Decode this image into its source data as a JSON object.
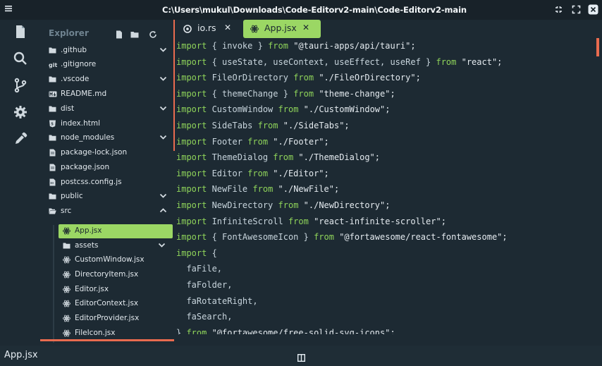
{
  "window": {
    "title": "C:\\Users\\mukul\\Downloads\\Code-Editorv2-main\\Code-Editorv2-main"
  },
  "activity_bar": [
    "files-icon",
    "search-icon",
    "source-control-icon",
    "settings-icon",
    "eyedropper-icon"
  ],
  "explorer": {
    "title": "Explorer",
    "tree": [
      {
        "label": ".github",
        "icon": "folder-icon",
        "chevron": true
      },
      {
        "label": ".gitignore",
        "icon": "git-icon",
        "chevron": false
      },
      {
        "label": ".vscode",
        "icon": "folder-icon",
        "chevron": true
      },
      {
        "label": "README.md",
        "icon": "markdown-icon",
        "chevron": false
      },
      {
        "label": "dist",
        "icon": "folder-icon",
        "chevron": true
      },
      {
        "label": "index.html",
        "icon": "html-icon",
        "chevron": false
      },
      {
        "label": "node_modules",
        "icon": "folder-icon",
        "chevron": true
      },
      {
        "label": "package-lock.json",
        "icon": "file-icon",
        "chevron": false
      },
      {
        "label": "package.json",
        "icon": "file-icon",
        "chevron": false
      },
      {
        "label": "postcss.config.js",
        "icon": "js-icon",
        "chevron": false
      },
      {
        "label": "public",
        "icon": "folder-icon",
        "chevron": true
      },
      {
        "label": "src",
        "icon": "folder-open-icon",
        "chevron": true,
        "expanded": true
      },
      {
        "label": "App.jsx",
        "icon": "react-icon",
        "chevron": false,
        "selected": true
      },
      {
        "label": "assets",
        "icon": "folder-icon",
        "chevron": true
      },
      {
        "label": "CustomWindow.jsx",
        "icon": "react-icon",
        "chevron": false
      },
      {
        "label": "DirectoryItem.jsx",
        "icon": "react-icon",
        "chevron": false
      },
      {
        "label": "Editor.jsx",
        "icon": "react-icon",
        "chevron": false
      },
      {
        "label": "EditorContext.jsx",
        "icon": "react-icon",
        "chevron": false
      },
      {
        "label": "EditorProvider.jsx",
        "icon": "react-icon",
        "chevron": false
      },
      {
        "label": "FileIcon.jsx",
        "icon": "react-icon",
        "chevron": false
      }
    ]
  },
  "tabs": [
    {
      "label": "io.rs",
      "icon": "rust-icon",
      "active": false
    },
    {
      "label": "App.jsx",
      "icon": "react-icon",
      "active": true
    }
  ],
  "code": [
    [
      [
        "kw",
        "import"
      ],
      [
        "t",
        " { invoke } "
      ],
      [
        "kw",
        "from"
      ],
      [
        "s",
        " \"@tauri-apps/api/tauri\";"
      ]
    ],
    [
      [
        "kw",
        "import"
      ],
      [
        "t",
        " { useState, useContext, useEffect, useRef } "
      ],
      [
        "kw",
        "from"
      ],
      [
        "s",
        " \"react\";"
      ]
    ],
    [
      [
        "kw",
        "import"
      ],
      [
        "t",
        " FileOrDirectory "
      ],
      [
        "kw",
        "from"
      ],
      [
        "s",
        " \"./FileOrDirectory\";"
      ]
    ],
    [
      [
        "kw",
        "import"
      ],
      [
        "t",
        " { themeChange } "
      ],
      [
        "kw",
        "from"
      ],
      [
        "s",
        " \"theme-change\";"
      ]
    ],
    [
      [
        "kw",
        "import"
      ],
      [
        "t",
        " CustomWindow "
      ],
      [
        "kw",
        "from"
      ],
      [
        "s",
        " \"./CustomWindow\";"
      ]
    ],
    [
      [
        "kw",
        "import"
      ],
      [
        "t",
        " SideTabs "
      ],
      [
        "kw",
        "from"
      ],
      [
        "s",
        " \"./SideTabs\";"
      ]
    ],
    [
      [
        "kw",
        "import"
      ],
      [
        "t",
        " Footer "
      ],
      [
        "kw",
        "from"
      ],
      [
        "s",
        " \"./Footer\";"
      ]
    ],
    [
      [
        "kw",
        "import"
      ],
      [
        "t",
        " ThemeDialog "
      ],
      [
        "kw",
        "from"
      ],
      [
        "s",
        " \"./ThemeDialog\";"
      ]
    ],
    [
      [
        "kw",
        "import"
      ],
      [
        "t",
        " Editor "
      ],
      [
        "kw",
        "from"
      ],
      [
        "s",
        " \"./Editor\";"
      ]
    ],
    [
      [
        "kw",
        "import"
      ],
      [
        "t",
        " NewFile "
      ],
      [
        "kw",
        "from"
      ],
      [
        "s",
        " \"./NewFile\";"
      ]
    ],
    [
      [
        "kw",
        "import"
      ],
      [
        "t",
        " NewDirectory "
      ],
      [
        "kw",
        "from"
      ],
      [
        "s",
        " \"./NewDirectory\";"
      ]
    ],
    [
      [
        "kw",
        "import"
      ],
      [
        "t",
        " InfiniteScroll "
      ],
      [
        "kw",
        "from"
      ],
      [
        "s",
        " \"react-infinite-scroller\";"
      ]
    ],
    [
      [
        "kw",
        "import"
      ],
      [
        "t",
        " { FontAwesomeIcon } "
      ],
      [
        "kw",
        "from"
      ],
      [
        "s",
        " \"@fortawesome/react-fontawesome\";"
      ]
    ],
    [
      [
        "kw",
        "import"
      ],
      [
        "t",
        " {"
      ]
    ],
    [
      [
        "t",
        "  faFile,"
      ]
    ],
    [
      [
        "t",
        "  faFolder,"
      ]
    ],
    [
      [
        "t",
        "  faRotateRight,"
      ]
    ],
    [
      [
        "t",
        "  faSearch,"
      ]
    ],
    [
      [
        "t",
        "} "
      ],
      [
        "kw",
        "from"
      ],
      [
        "s",
        " \"@fortawesome/free-solid-svg-icons\";"
      ]
    ]
  ],
  "status_bar": {
    "file": "App.jsx"
  },
  "colors": {
    "accent": "#9bd764",
    "marker": "#e96b4f",
    "background": "#1d2a33"
  }
}
